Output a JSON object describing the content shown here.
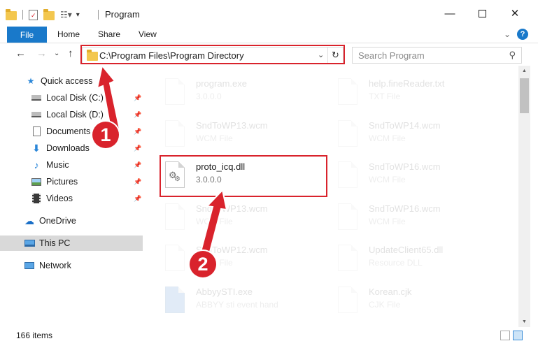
{
  "window": {
    "title": "Program",
    "minimize_icon": "minimize-icon",
    "maximize_icon": "maximize-icon",
    "close_icon": "close-icon"
  },
  "ribbon": {
    "tabs": [
      "File",
      "Home",
      "Share",
      "View"
    ],
    "expand_icon": "chevron-down-icon",
    "help_label": "?"
  },
  "address": {
    "path": "C:\\Program Files\\Program Directory",
    "refresh_icon": "refresh-icon"
  },
  "search": {
    "placeholder": "Search Program"
  },
  "sidebar": {
    "items": [
      {
        "label": "Quick access",
        "icon": "star-icon",
        "pinned": false
      },
      {
        "label": "Local Disk (C:)",
        "icon": "drive-icon",
        "pinned": true
      },
      {
        "label": "Local Disk (D:)",
        "icon": "drive-icon",
        "pinned": true
      },
      {
        "label": "Documents",
        "icon": "documents-icon",
        "pinned": true
      },
      {
        "label": "Downloads",
        "icon": "download-icon",
        "pinned": true
      },
      {
        "label": "Music",
        "icon": "music-icon",
        "pinned": true
      },
      {
        "label": "Pictures",
        "icon": "pictures-icon",
        "pinned": true
      },
      {
        "label": "Videos",
        "icon": "videos-icon",
        "pinned": true
      },
      {
        "label": "OneDrive",
        "icon": "cloud-icon",
        "pinned": false
      },
      {
        "label": "This PC",
        "icon": "computer-icon",
        "pinned": false,
        "selected": true
      },
      {
        "label": "Network",
        "icon": "network-icon",
        "pinned": false
      }
    ]
  },
  "files": {
    "left": [
      {
        "name": "program.exe",
        "type": "3.0.0.0",
        "faded": true
      },
      {
        "name": "SndToWP13.wcm",
        "type": "WCM File",
        "faded": true
      },
      {
        "name": "proto_icq.dll",
        "type": "3.0.0.0",
        "faded": false,
        "highlighted": true
      },
      {
        "name": "SndToWP13.wcm",
        "type": "WCM File",
        "faded": true
      },
      {
        "name": "SndToWP12.wcm",
        "type": "WCM File",
        "faded": true
      },
      {
        "name": "AbbyySTI.exe",
        "type": "ABBYY sti event hand",
        "faded": true
      }
    ],
    "right": [
      {
        "name": "help.fineReader.txt",
        "type": "TXT File",
        "faded": true
      },
      {
        "name": "SndToWP14.wcm",
        "type": "WCM File",
        "faded": true
      },
      {
        "name": "SndToWP16.wcm",
        "type": "WCM File",
        "faded": true
      },
      {
        "name": "SndToWP16.wcm",
        "type": "WCM File",
        "faded": true
      },
      {
        "name": "UpdateClient65.dll",
        "type": "Resource DLL",
        "faded": true
      },
      {
        "name": "Korean.cjk",
        "type": "CJK File",
        "faded": true
      }
    ]
  },
  "status": {
    "item_count": "166 items"
  },
  "callouts": [
    "1",
    "2"
  ],
  "colors": {
    "accent": "#1979ca",
    "annotation_red": "#d9232c",
    "selected_bg": "#d9d9d9"
  }
}
